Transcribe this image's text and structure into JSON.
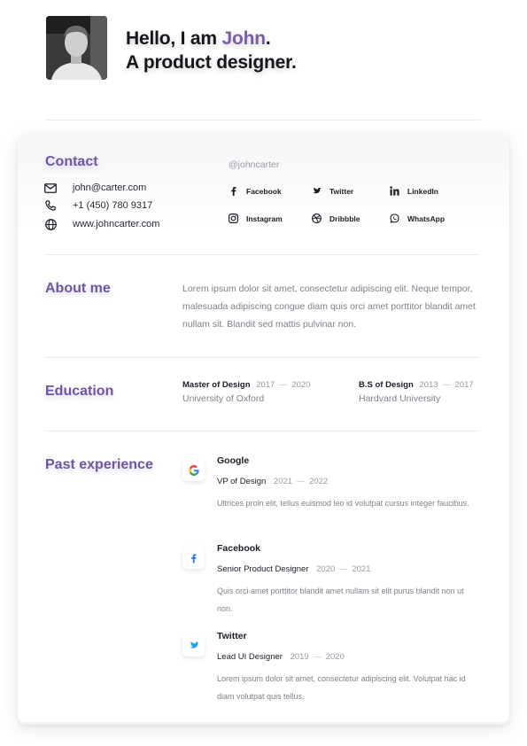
{
  "header": {
    "greeting_prefix": "Hello, I am ",
    "name": "John",
    "greeting_suffix": ".",
    "tagline": "A product designer.",
    "accent_color": "#7b5ea7"
  },
  "contact": {
    "title": "Contact",
    "handle": "@johncarter",
    "email": "john@carter.com",
    "phone": "+1 (450) 780 9317",
    "website": "www.johncarter.com",
    "socials": [
      {
        "label": "Facebook",
        "icon": "facebook-icon"
      },
      {
        "label": "Twitter",
        "icon": "twitter-icon"
      },
      {
        "label": "LinkedIn",
        "icon": "linkedin-icon"
      },
      {
        "label": "Instagram",
        "icon": "instagram-icon"
      },
      {
        "label": "Dribbble",
        "icon": "dribbble-icon"
      },
      {
        "label": "WhatsApp",
        "icon": "whatsapp-icon"
      }
    ]
  },
  "about": {
    "title": "About me",
    "text": "Lorem ipsum dolor sit amet, consectetur adipiscing elit. Neque tempor, malesuada adipiscing congue diam quis orci amet porttitor blandit amet nullam sit. Blandit sed mattis pulvinar non."
  },
  "education": {
    "title": "Education",
    "items": [
      {
        "degree": "Master of Design",
        "start": "2017",
        "end": "2020",
        "school": "University of Oxford"
      },
      {
        "degree": "B.S of Design",
        "start": "2013",
        "end": "2017",
        "school": "Hardvard University"
      }
    ]
  },
  "experience": {
    "title": "Past experience",
    "items": [
      {
        "company": "Google",
        "role": "VP of Design",
        "start": "2021",
        "end": "2022",
        "description": "Ultrices proin elit, tellus euismod leo id volutpat cursus integer faucibus.",
        "icon": "google-icon"
      },
      {
        "company": "Facebook",
        "role": "Senior Product Designer",
        "start": "2020",
        "end": "2021",
        "description": "Quis orci amet porttitor blandit amet nullam sit elit purus blandit non ut non.",
        "icon": "facebook-icon"
      },
      {
        "company": "Twitter",
        "role": "Lead UI Designer",
        "start": "2019",
        "end": "2020",
        "description": "Lorem ipsum dolor sit amet, consectetur adipiscing elit. Volutpat hac id diam volutpat quis tellus.",
        "icon": "twitter-icon"
      }
    ]
  }
}
